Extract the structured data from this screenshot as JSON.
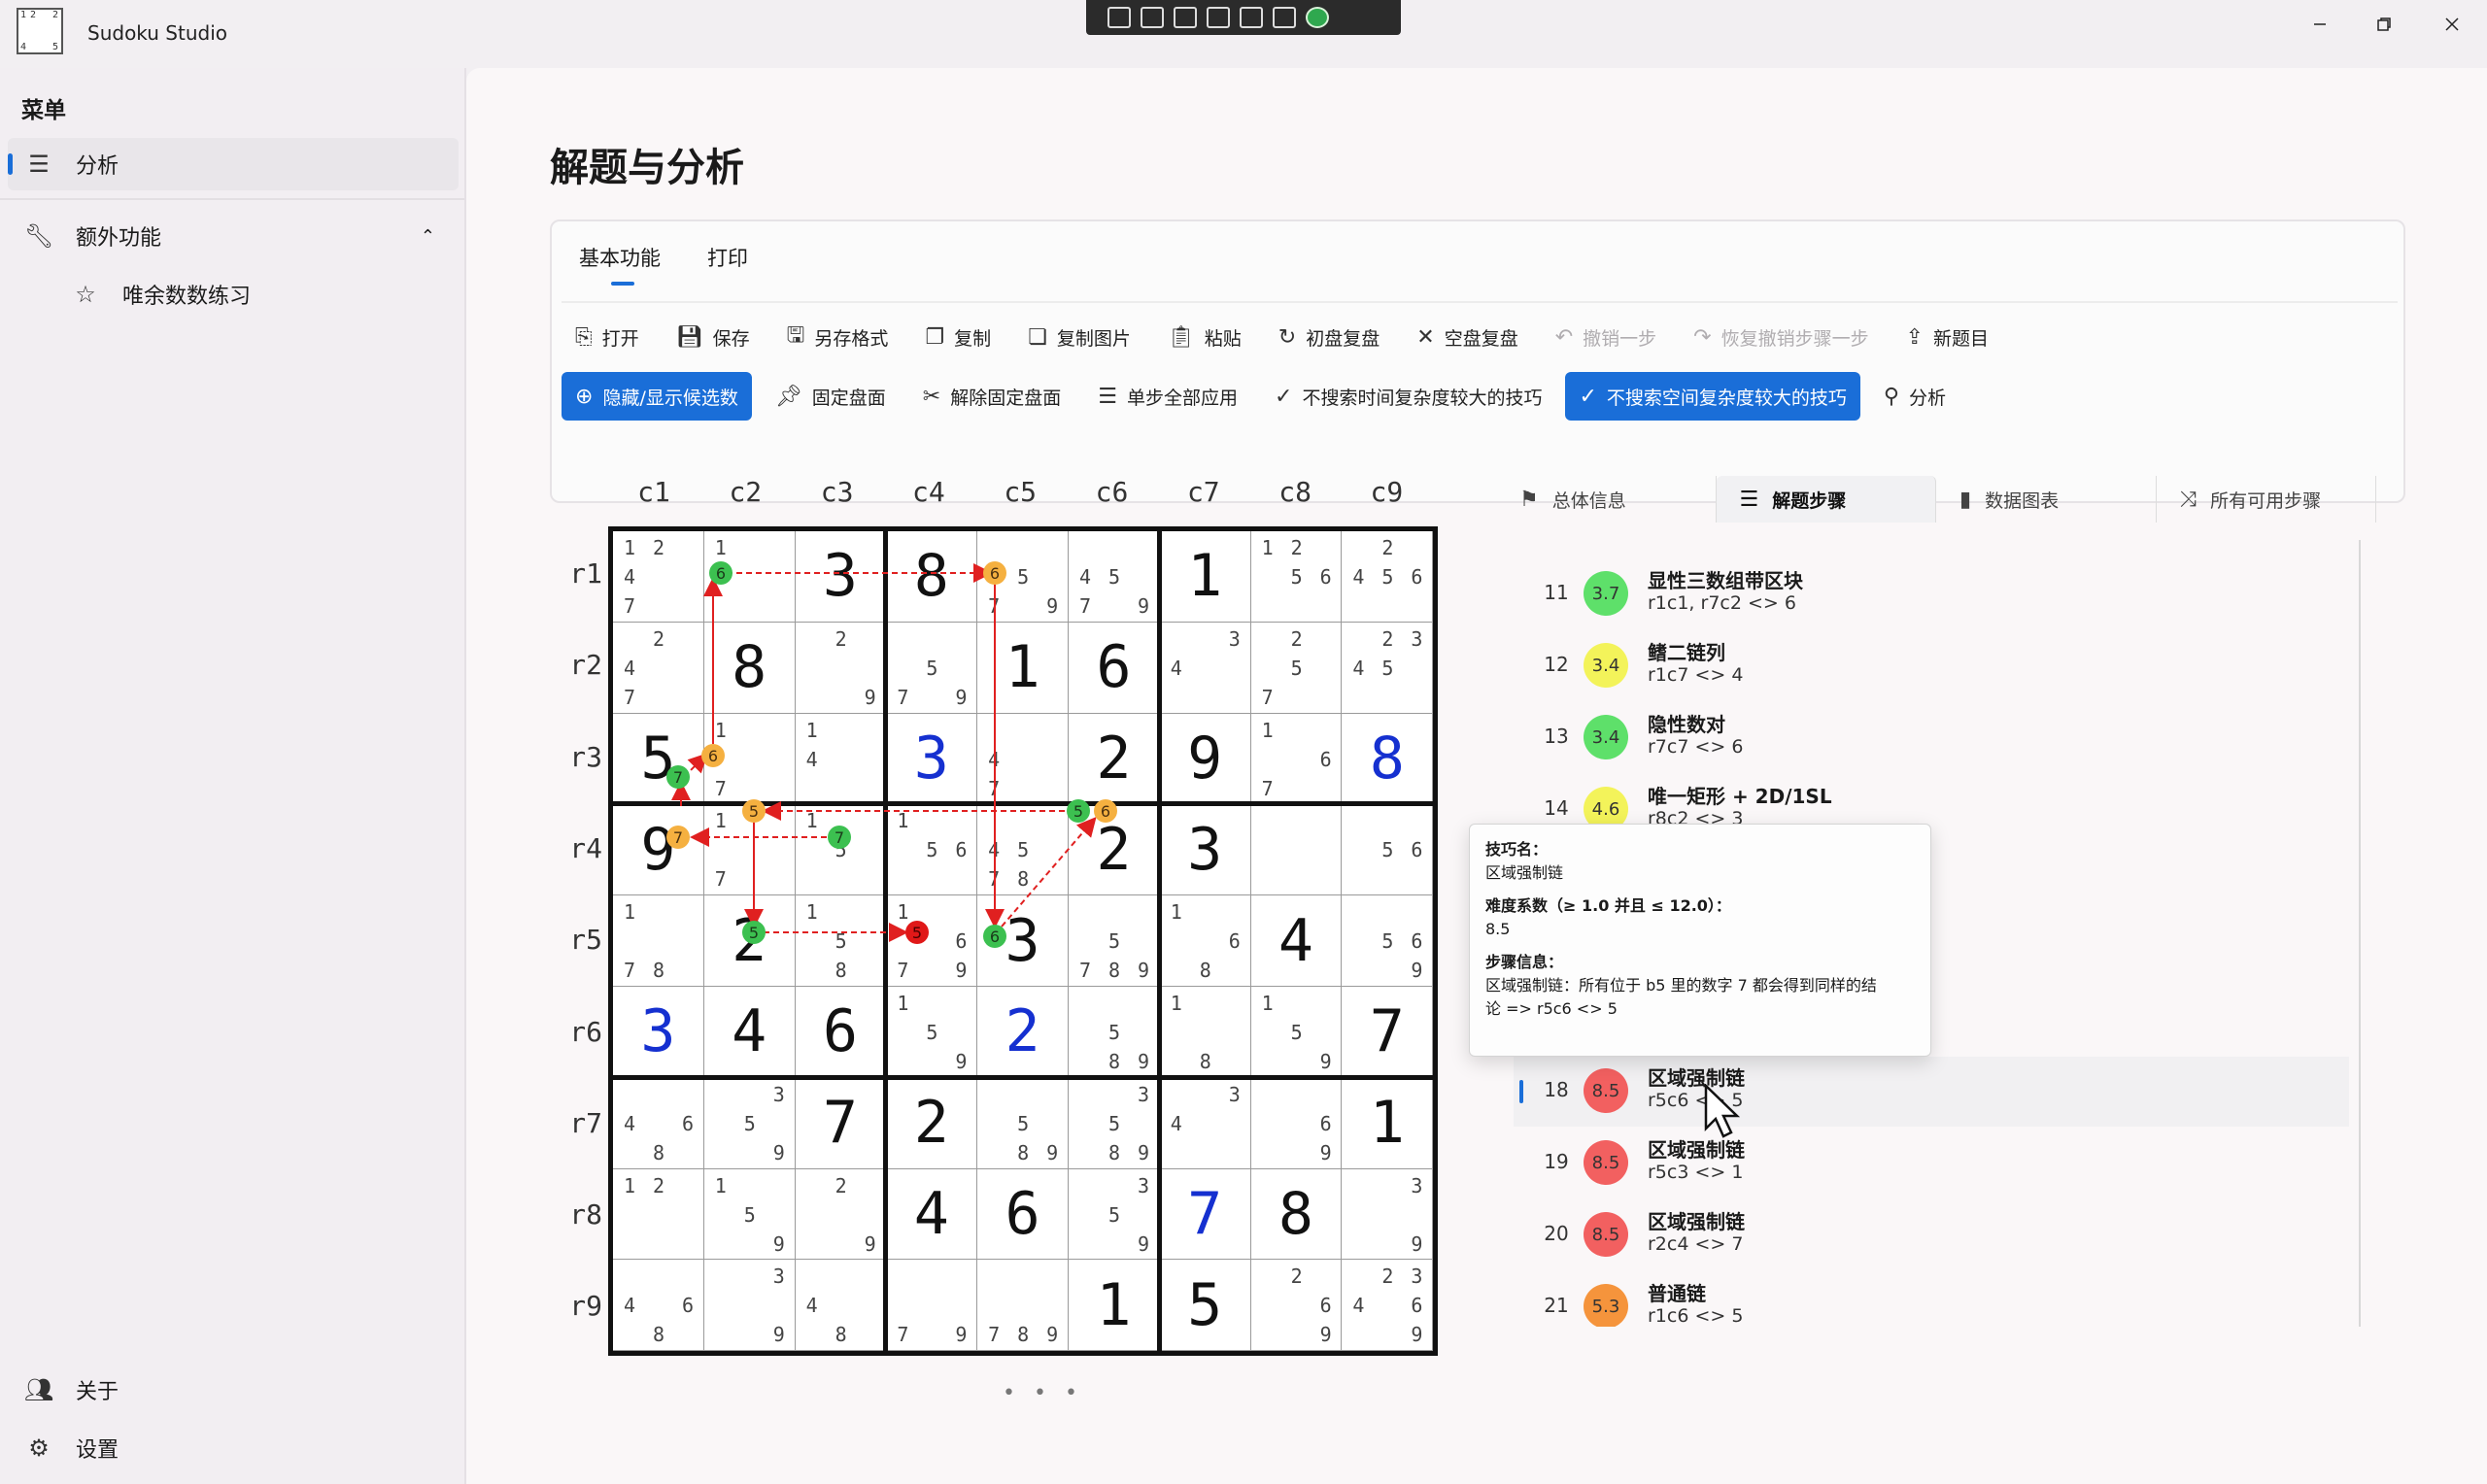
{
  "app": {
    "title": "Sudoku Studio",
    "logo_text": "Sudoku Studio"
  },
  "sidebar": {
    "heading": "菜单",
    "items": [
      {
        "label": "分析",
        "icon": "list-icon"
      },
      {
        "label": "额外功能",
        "icon": "wrench-icon"
      },
      {
        "label": "唯余数数练习",
        "icon": "star-icon"
      }
    ],
    "bottom": [
      {
        "label": "关于",
        "icon": "people-icon"
      },
      {
        "label": "设置",
        "icon": "gear-icon"
      }
    ]
  },
  "page": {
    "title": "解题与分析"
  },
  "tabs": [
    {
      "label": "基本功能"
    },
    {
      "label": "打印"
    }
  ],
  "toolbar1": [
    {
      "label": "打开",
      "icon": "open-icon"
    },
    {
      "label": "保存",
      "icon": "save-icon"
    },
    {
      "label": "另存格式",
      "icon": "save-as-icon"
    },
    {
      "label": "复制",
      "icon": "copy-icon"
    },
    {
      "label": "复制图片",
      "icon": "copy-image-icon"
    },
    {
      "label": "粘贴",
      "icon": "paste-icon"
    },
    {
      "label": "初盘复盘",
      "icon": "reset-icon"
    },
    {
      "label": "空盘复盘",
      "icon": "clear-icon"
    },
    {
      "label": "撤销一步",
      "icon": "undo-icon"
    },
    {
      "label": "恢复撤销步骤一步",
      "icon": "redo-icon"
    },
    {
      "label": "新题目",
      "icon": "new-icon"
    }
  ],
  "toolbar2": [
    {
      "label": "隐藏/显示候选数",
      "icon": "zoom-icon"
    },
    {
      "label": "固定盘面",
      "icon": "pin-icon"
    },
    {
      "label": "解除固定盘面",
      "icon": "unpin-icon"
    },
    {
      "label": "单步全部应用",
      "icon": "lines-icon"
    },
    {
      "label": "不搜索时间复杂度较大的技巧",
      "icon": "check-icon"
    },
    {
      "label": "不搜索空间复杂度较大的技巧",
      "icon": "check-icon"
    },
    {
      "label": "分析",
      "icon": "search-icon"
    }
  ],
  "board": {
    "col_labels": [
      "c1",
      "c2",
      "c3",
      "c4",
      "c5",
      "c6",
      "c7",
      "c8",
      "c9"
    ],
    "row_labels": [
      "r1",
      "r2",
      "r3",
      "r4",
      "r5",
      "r6",
      "r7",
      "r8",
      "r9"
    ],
    "values": [
      "00380000",
      "",
      "",
      "",
      "",
      "",
      "",
      "",
      ""
    ],
    "rows": [
      "--38--1--",
      "-8--16---",
      "5--3-29-8",
      "9----23--",
      "-2--3--4-",
      "346-2---7",
      "--72----1",
      "---46-78-",
      "-----15--"
    ],
    "solved_cells": [
      "r3c4",
      "r3c9",
      "r6c1",
      "r6c5",
      "r8c7"
    ],
    "candidates": {
      "r1c1": "1247",
      "r1c2": "1",
      "r1c5": "4579",
      "r1c6": "4579",
      "r1c7": "17",
      "r1c8": "1256",
      "r1c9": "2456",
      "r2c1": "247",
      "r2c3": "29",
      "r2c4": "579",
      "r2c7": "34",
      "r2c8": "257",
      "r2c9": "2345",
      "r3c2": "17",
      "r3c3": "14",
      "r3c5": "47",
      "r3c8": "167",
      "r4c2": "17",
      "r4c3": "15",
      "r4c4": "156",
      "r4c5": "4578",
      "r4c6": "48",
      "r4c9": "56",
      "r5c1": "178",
      "r5c3": "158",
      "r5c4": "1679",
      "r5c6": "5789",
      "r5c7": "168",
      "r5c9": "569",
      "r6c4": "159",
      "r6c6": "589",
      "r6c7": "18",
      "r6c8": "159",
      "r7c1": "468",
      "r7c2": "359",
      "r7c5": "589",
      "r7c6": "3589",
      "r7c7": "34",
      "r7c8": "69",
      "r8c1": "12",
      "r8c2": "159",
      "r8c3": "29",
      "r8c6": "359",
      "r8c9": "39",
      "r9c1": "468",
      "r9c2": "39",
      "r9c3": "48",
      "r9c4": "79",
      "r9c5": "789",
      "r9c8": "269",
      "r9c9": "23469"
    }
  },
  "right_tabs": [
    {
      "label": "总体信息",
      "icon": "flag-icon"
    },
    {
      "label": "解题步骤",
      "icon": "list-icon"
    },
    {
      "label": "数据图表",
      "icon": "chart-icon"
    },
    {
      "label": "所有可用步骤",
      "icon": "shuffle-icon"
    }
  ],
  "steps": [
    {
      "num": "11",
      "score": "3.7",
      "color": "#5ee06a",
      "name": "显性三数组带区块",
      "desc": "r1c1, r7c2 <> 6"
    },
    {
      "num": "12",
      "score": "3.4",
      "color": "#f3f35a",
      "name": "鳍二链列",
      "desc": "r1c7 <> 4"
    },
    {
      "num": "13",
      "score": "3.4",
      "color": "#5ee06a",
      "name": "隐性数对",
      "desc": "r7c7 <> 6"
    },
    {
      "num": "14",
      "score": "4.6",
      "color": "#f3f35a",
      "name": "唯一矩形 + 2D/1SL",
      "desc": "r8c2 <> 3"
    },
    {
      "num": "18",
      "score": "8.5",
      "color": "#f26060",
      "name": "区域强制链",
      "desc": "r5c6 <> 5"
    },
    {
      "num": "19",
      "score": "8.5",
      "color": "#f26060",
      "name": "区域强制链",
      "desc": "r5c3 <> 1"
    },
    {
      "num": "20",
      "score": "8.5",
      "color": "#f26060",
      "name": "区域强制链",
      "desc": "r2c4 <> 7"
    },
    {
      "num": "21",
      "score": "5.3",
      "color": "#f5943c",
      "name": "普通链",
      "desc": "r1c6 <> 5"
    }
  ],
  "tooltip": {
    "l1": "技巧名：",
    "l2": "区域强制链",
    "l3": "难度系数（≥ 1.0 并且 ≤ 12.0）：",
    "l4": "8.5",
    "l5": "步骤信息：",
    "l6": "区域强制链：所有位于 b5 里的数字 7 都会得到同样的结",
    "l7": "论 => r5c6 <> 5"
  },
  "pager": "• • •"
}
